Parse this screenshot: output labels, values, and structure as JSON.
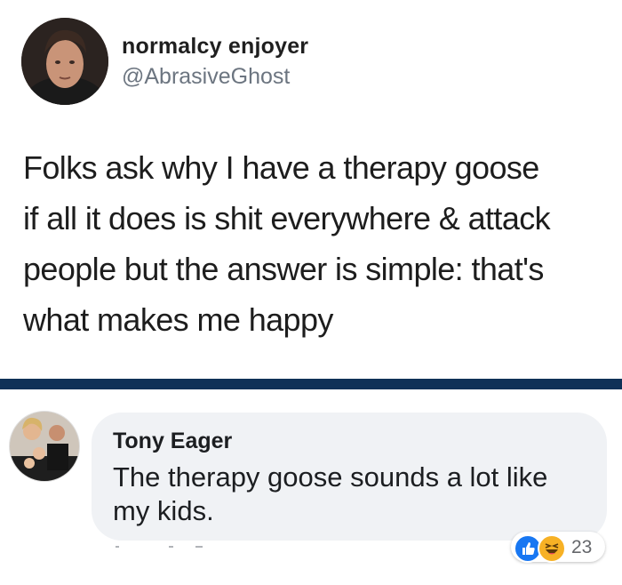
{
  "tweet": {
    "display_name": "normalcy enjoyer",
    "handle": "@AbrasiveGhost",
    "lines": [
      "Folks ask why I have a therapy goose",
      "if all it does is shit everywhere & attack",
      "people but the answer is simple: that's",
      "what makes me happy"
    ]
  },
  "comment": {
    "author": "Tony Eager",
    "lines": [
      "The therapy goose sounds a lot like",
      "my kids."
    ],
    "reactions": {
      "icons": [
        "like-icon",
        "haha-icon"
      ],
      "count": "23"
    }
  },
  "colors": {
    "divider": "#0f3157",
    "bubble": "#f0f2f5",
    "like": "#1877f2",
    "haha": "#f7b125",
    "handle": "#6c7580"
  }
}
